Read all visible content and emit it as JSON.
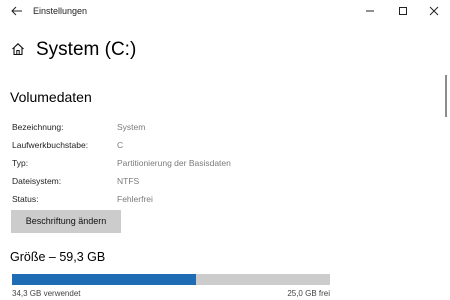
{
  "window": {
    "title": "Einstellungen",
    "back_icon": "back-arrow-icon",
    "minimize_icon": "minimize-icon",
    "maximize_icon": "maximize-icon",
    "close_icon": "close-icon"
  },
  "header": {
    "icon": "home-icon",
    "title": "System (C:)"
  },
  "volume": {
    "section_title": "Volumedaten",
    "properties": [
      {
        "label": "Bezeichnung:",
        "value": "System"
      },
      {
        "label": "Laufwerkbuchstabe:",
        "value": "C"
      },
      {
        "label": "Typ:",
        "value": "Partitionierung der Basisdaten"
      },
      {
        "label": "Dateisystem:",
        "value": "NTFS"
      },
      {
        "label": "Status:",
        "value": "Fehlerfrei"
      }
    ],
    "rename_button_label": "Beschriftung ändern"
  },
  "size": {
    "title": "Größe – 59,3 GB",
    "used_label": "34,3 GB verwendet",
    "free_label": "25,0 GB frei",
    "used_fraction": 0.578
  },
  "colors": {
    "accent": "#1e6db4",
    "bar_background": "#cccccc",
    "button_background": "#cccccc",
    "value_text": "#7a7a7a"
  }
}
